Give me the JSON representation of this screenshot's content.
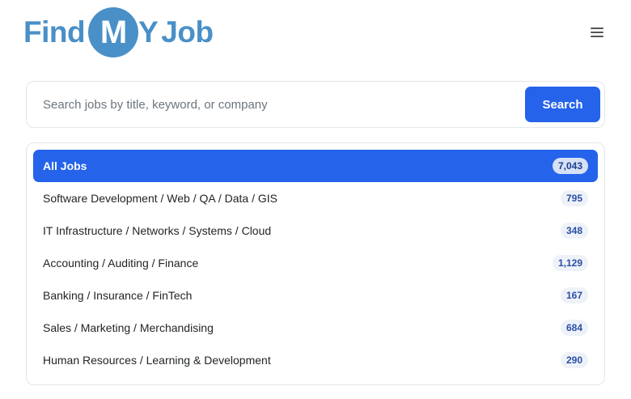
{
  "header": {
    "logo": {
      "part1": "Find",
      "circle": "M",
      "part2": "Y",
      "part3": "Job"
    },
    "menu_icon": "hamburger-icon"
  },
  "search": {
    "placeholder": "Search jobs by title, keyword, or company",
    "button_label": "Search"
  },
  "categories": [
    {
      "label": "All Jobs",
      "count": "7,043",
      "active": true
    },
    {
      "label": "Software Development / Web / QA / Data / GIS",
      "count": "795"
    },
    {
      "label": "IT Infrastructure / Networks / Systems / Cloud",
      "count": "348"
    },
    {
      "label": "Accounting / Auditing / Finance",
      "count": "1,129"
    },
    {
      "label": "Banking / Insurance / FinTech",
      "count": "167"
    },
    {
      "label": "Sales / Marketing / Merchandising",
      "count": "684"
    },
    {
      "label": "Human Resources / Learning & Development",
      "count": "290"
    }
  ],
  "colors": {
    "brand": "#4a90c8",
    "accent": "#2563eb"
  }
}
